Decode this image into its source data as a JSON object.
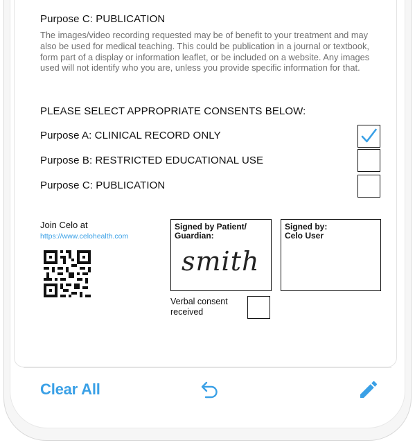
{
  "purpose_c_section": {
    "heading": "Purpose C: PUBLICATION",
    "description": "The images/video recording requested may be of benefit to your treatment and may also be used for medical teaching. This could be publication in a journal or textbook, form part of a display or information leaflet, or be included on a website. Any images used will not identify who you are, unless you provide specific information for that."
  },
  "consents": {
    "title": "PLEASE SELECT APPROPRIATE CONSENTS BELOW:",
    "options": [
      {
        "label": "Purpose A: CLINICAL RECORD ONLY",
        "checked": true
      },
      {
        "label": "Purpose B: RESTRICTED EDUCATIONAL USE",
        "checked": false
      },
      {
        "label": "Purpose C: PUBLICATION",
        "checked": false
      }
    ],
    "check_color": "#3aa0e6"
  },
  "join": {
    "text": "Join Celo at",
    "url": "https://www.celohealth.com"
  },
  "signature_patient": {
    "label_line1": "Signed by Patient/",
    "label_line2": "Guardian:",
    "signature": "smith"
  },
  "signature_user": {
    "label_line1": "Signed by:",
    "label_line2": "Celo User"
  },
  "verbal_consent": {
    "line1": "Verbal consent",
    "line2": "received",
    "checked": false
  },
  "toolbar": {
    "clear_label": "Clear All",
    "undo_icon": "undo-arrow-icon",
    "edit_icon": "pencil-icon",
    "accent": "#3aa0e6"
  }
}
